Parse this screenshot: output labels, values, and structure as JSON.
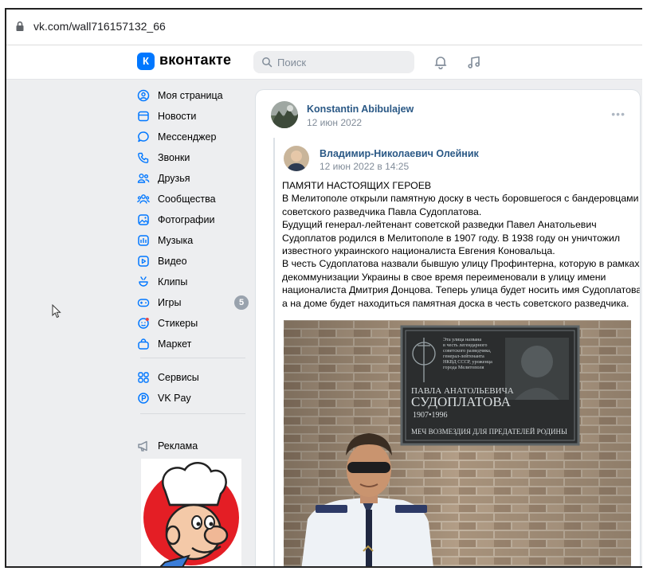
{
  "browser": {
    "url": "vk.com/wall716157132_66"
  },
  "header": {
    "logo_mark": "К",
    "logo_text": "вконтакте",
    "search_placeholder": "Поиск"
  },
  "sidebar": {
    "items": [
      {
        "label": "Моя страница",
        "icon": "user-circle-icon"
      },
      {
        "label": "Новости",
        "icon": "news-icon"
      },
      {
        "label": "Мессенджер",
        "icon": "message-icon"
      },
      {
        "label": "Звонки",
        "icon": "phone-icon"
      },
      {
        "label": "Друзья",
        "icon": "friends-icon"
      },
      {
        "label": "Сообщества",
        "icon": "communities-icon"
      },
      {
        "label": "Фотографии",
        "icon": "photo-icon"
      },
      {
        "label": "Музыка",
        "icon": "music-icon"
      },
      {
        "label": "Видео",
        "icon": "video-icon"
      },
      {
        "label": "Клипы",
        "icon": "clips-icon"
      },
      {
        "label": "Игры",
        "icon": "gamepad-icon",
        "badge": "5"
      },
      {
        "label": "Стикеры",
        "icon": "sticker-icon"
      },
      {
        "label": "Маркет",
        "icon": "market-icon"
      },
      {
        "label": "Сервисы",
        "icon": "services-icon"
      },
      {
        "label": "VK Pay",
        "icon": "vkpay-icon"
      },
      {
        "label": "Реклама",
        "icon": "megaphone-icon"
      }
    ]
  },
  "post": {
    "author": "Konstantin Abibulajew",
    "date": "12 июн 2022",
    "repost": {
      "author": "Владимир-Николаевич Олейник",
      "date": "12 июн 2022 в 14:25",
      "lines": [
        "ПАМЯТИ НАСТОЯЩИХ ГЕРОЕВ",
        "В Мелитополе открыли памятную доску в честь боровшегося с бандеровцами",
        "советского разведчика Павла Судоплатова.",
        "Будущий генерал-лейтенант советской разведки Павел Анатольевич",
        "Судоплатов родился в Мелитополе в 1907 году. В 1938 году он уничтожил",
        "известного украинского националиста Евгения Коновальца.",
        "В честь Судоплатова назвали бывшую улицу Профинтерна, которую в рамках",
        "декоммунизации Украины в свое время переименовали в улицу имени",
        "националиста Дмитрия Донцова. Теперь улица будет носить имя Судоплатова,",
        "а на доме будет находиться памятная доска в честь советского разведчика."
      ],
      "plaque": {
        "small_text": [
          "Эта улица названа",
          "в честь легендарного",
          "советского разведчика,",
          "генерал-лейтенанта",
          "НКВД СССР, уроженца",
          "города Мелитополя"
        ],
        "name_line1": "ПАВЛА АНАТОЛЬЕВИЧА",
        "name_line2": "СУДОПЛАТОВА",
        "years": "1907•1996",
        "motto": "МЕЧ ВОЗМЕЗДИЯ ДЛЯ ПРЕДАТЕЛЕЙ РОДИНЫ"
      }
    }
  },
  "colors": {
    "vk_blue": "#0077ff",
    "link_blue": "#2a5885",
    "muted": "#818c99",
    "page_bg": "#edeef0"
  }
}
